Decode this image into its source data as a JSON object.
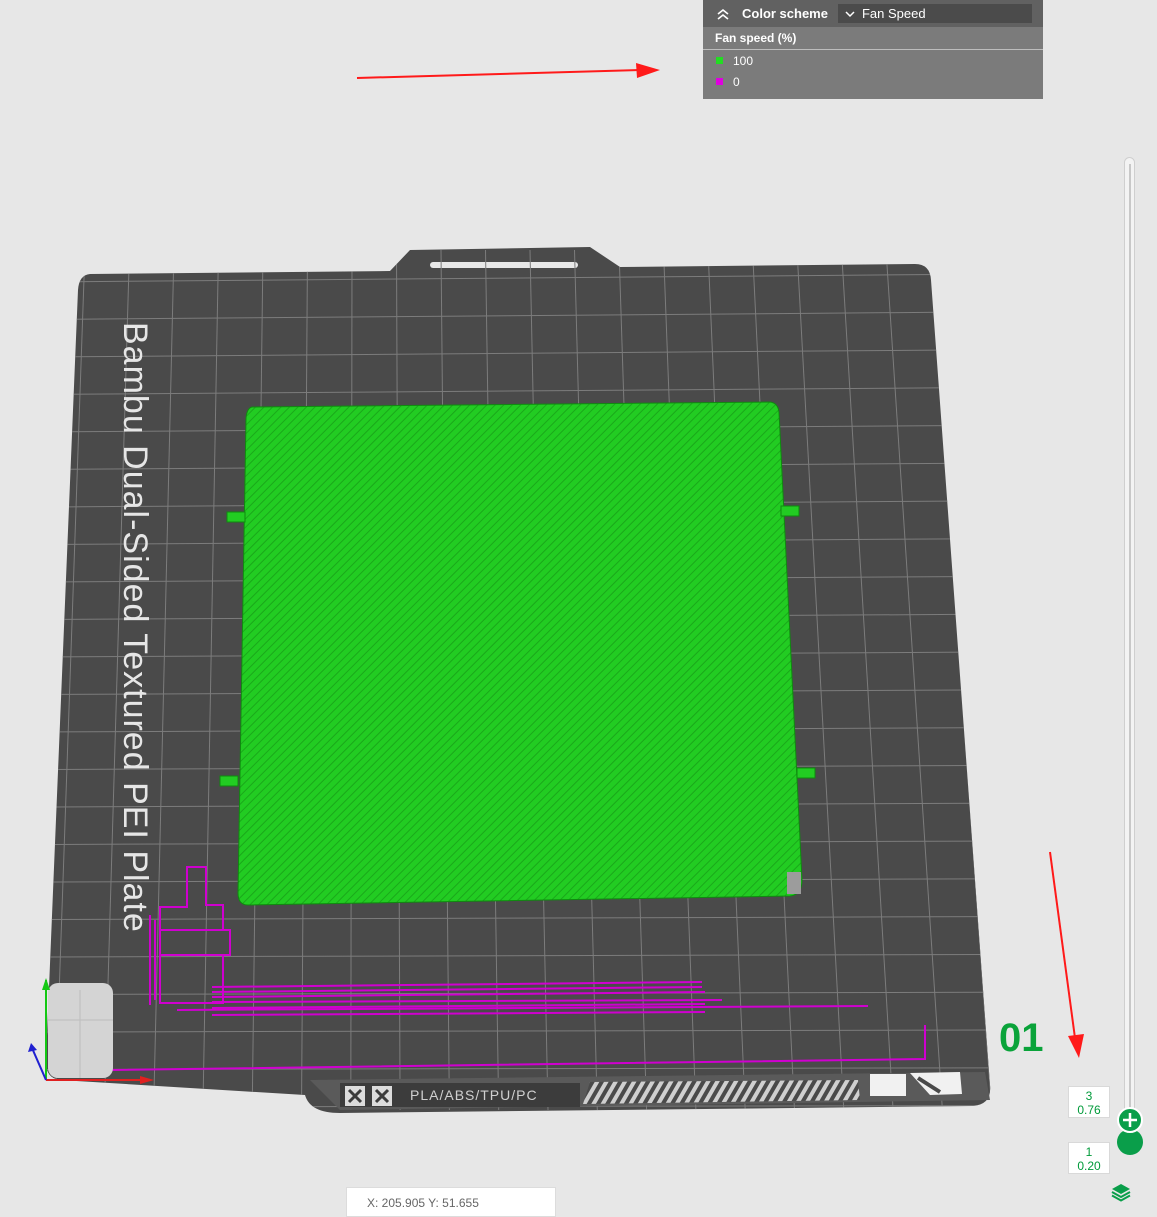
{
  "legend": {
    "color_scheme_label": "Color scheme",
    "color_scheme_value": "Fan Speed",
    "title": "Fan speed (%)",
    "items": [
      {
        "label": "100",
        "color": "#22dd22"
      },
      {
        "label": "0",
        "color": "#e000e0"
      }
    ]
  },
  "plate": {
    "name": "Bambu Dual-Sided Textured PEI Plate",
    "number": "01",
    "materials": "PLA/ABS/TPU/PC"
  },
  "slider": {
    "top_layer": "3",
    "top_height": "0.76",
    "bottom_layer": "1",
    "bottom_height": "0.20"
  },
  "coords": "X: 205.905  Y: 51.655",
  "colors": {
    "print_green": "#22cc22",
    "fan_zero_magenta": "#d000d0",
    "bed": "#4a4a4a",
    "accent": "#0a9e4a",
    "annotation_arrow": "#ff1a1a"
  },
  "icons": {
    "collapse": "double-chevron-up-icon",
    "dropdown": "chevron-down-icon",
    "layers": "layers-icon",
    "add": "plus-icon"
  }
}
